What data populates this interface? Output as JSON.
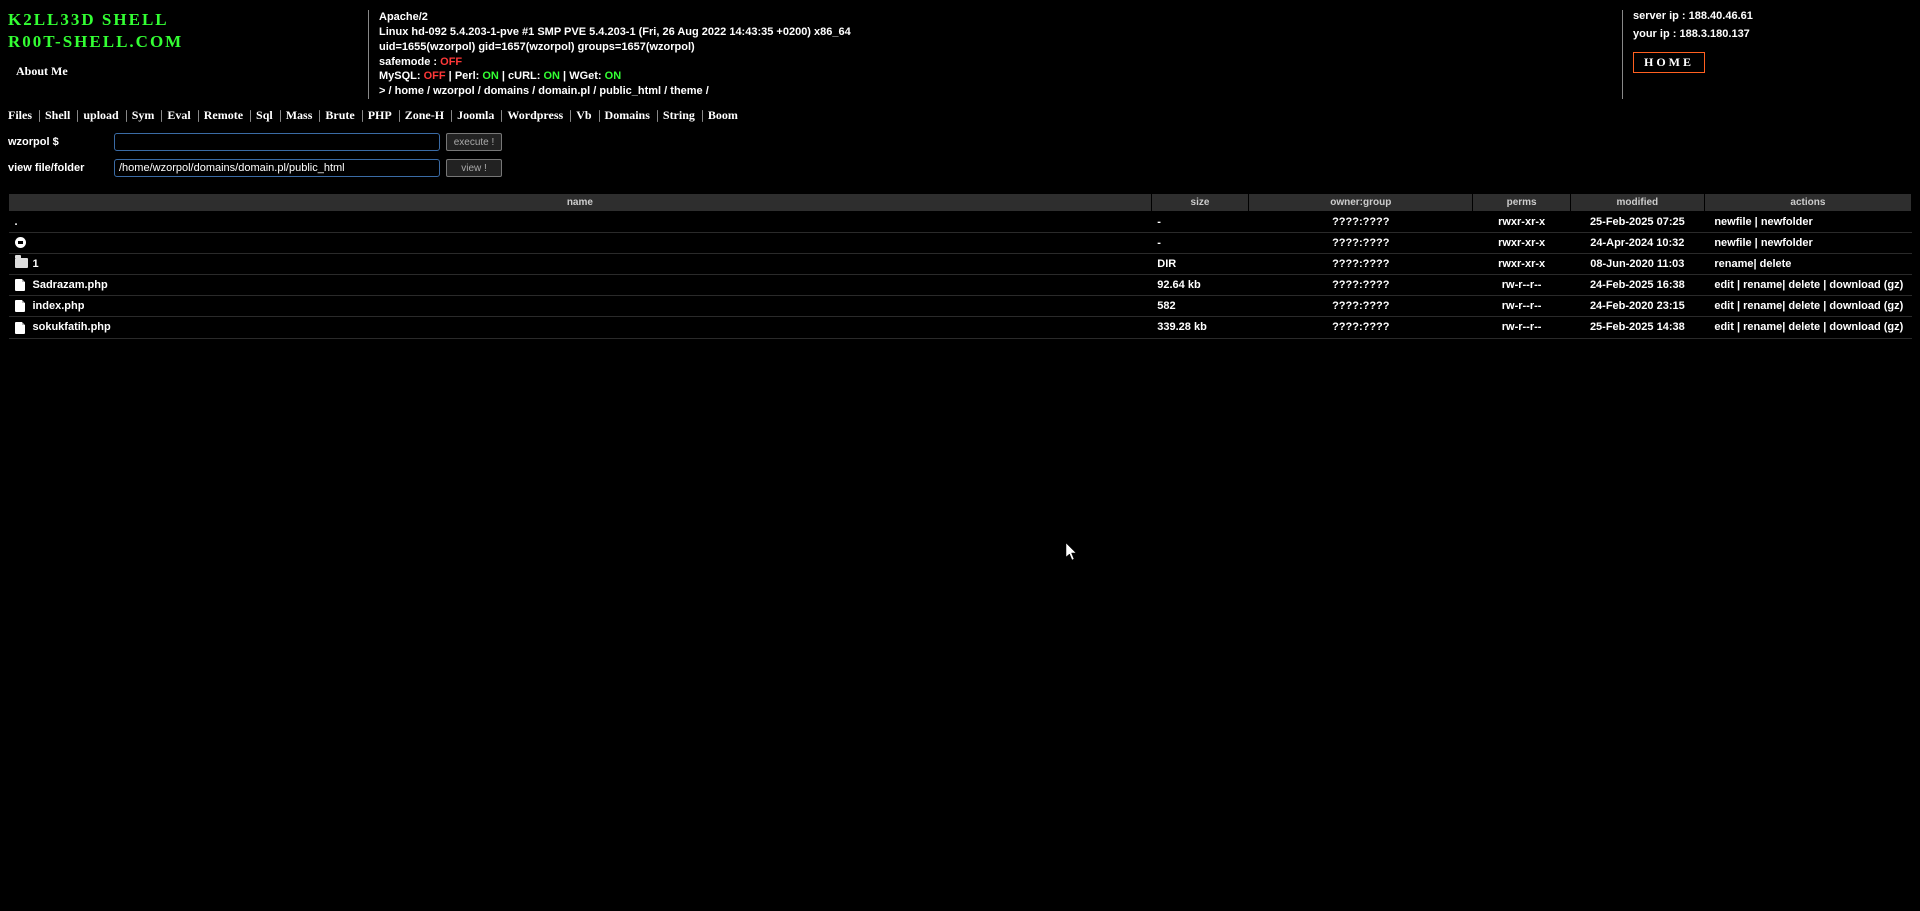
{
  "header": {
    "title1": "K2LL33D SHELL",
    "title2": "R00T-SHELL.COM",
    "about_me": "About Me"
  },
  "sysinfo": {
    "server": "Apache/2",
    "os": "Linux hd-092 5.4.203-1-pve #1 SMP PVE 5.4.203-1 (Fri, 26 Aug 2022 14:43:35 +0200) x86_64",
    "uid": "uid=1655(wzorpol) gid=1657(wzorpol) groups=1657(wzorpol)",
    "safemode_label": "safemode : ",
    "safemode_status": "OFF",
    "mysql_label": "MySQL: ",
    "mysql_status": "OFF",
    "perl_label": "Perl: ",
    "perl_status": "ON",
    "curl_label": "cURL: ",
    "curl_status": "ON",
    "wget_label": "WGet: ",
    "wget_status": "ON",
    "sep": " | ",
    "path_prefix": " >  / ",
    "path_parts": [
      "home",
      "wzorpol",
      "domains",
      "domain.pl",
      "public_html",
      "theme"
    ],
    "path_sep": " / "
  },
  "rightinfo": {
    "server_ip_label": "server ip : ",
    "server_ip": "188.40.46.61",
    "your_ip_label": "your ip : ",
    "your_ip": "188.3.180.137",
    "home_btn": "HOME"
  },
  "menu": [
    "Files",
    "Shell",
    "upload",
    "Sym",
    "Eval",
    "Remote",
    "Sql",
    "Mass",
    "Brute",
    "PHP",
    "Zone-H",
    "Joomla",
    "Wordpress",
    "Vb",
    "Domains",
    "String",
    "Boom"
  ],
  "form": {
    "cmd_label": "wzorpol $",
    "cmd_value": "",
    "execute_btn": "execute !",
    "view_label": "view file/folder",
    "view_value": "/home/wzorpol/domains/domain.pl/public_html",
    "view_btn": "view !"
  },
  "table": {
    "headers": {
      "name": "name",
      "size": "size",
      "owner": "owner:group",
      "perms": "perms",
      "modified": "modified",
      "actions": "actions"
    },
    "rows": [
      {
        "type": "dot",
        "name": ".",
        "size": "-",
        "owner": "????:????",
        "perms": "rwxr-xr-x",
        "modified": "25-Feb-2025 07:25",
        "actions": [
          "newfile",
          "newfolder"
        ],
        "action_sep": " | "
      },
      {
        "type": "up",
        "name": "",
        "size": "-",
        "owner": "????:????",
        "perms": "rwxr-xr-x",
        "modified": "24-Apr-2024 10:32",
        "actions": [
          "newfile",
          "newfolder"
        ],
        "action_sep": " | "
      },
      {
        "type": "folder",
        "name": "1",
        "size": "DIR",
        "owner": "????:????",
        "perms": "rwxr-xr-x",
        "modified": "08-Jun-2020 11:03",
        "actions": [
          "rename",
          "delete"
        ],
        "action_sep": "| "
      },
      {
        "type": "file",
        "name": "Sadrazam.php",
        "size": "92.64 kb",
        "owner": "????:????",
        "perms": "rw-r--r--",
        "modified": "24-Feb-2025 16:38",
        "actions": [
          "edit",
          "rename",
          "delete",
          "download (gz)"
        ],
        "action_sep": " | ",
        "action_sep2": "| "
      },
      {
        "type": "file",
        "name": "index.php",
        "size": "582",
        "owner": "????:????",
        "perms": "rw-r--r--",
        "modified": "24-Feb-2020 23:15",
        "actions": [
          "edit",
          "rename",
          "delete",
          "download (gz)"
        ],
        "action_sep": " | ",
        "action_sep2": "| "
      },
      {
        "type": "file",
        "name": "sokukfatih.php",
        "size": "339.28 kb",
        "owner": "????:????",
        "perms": "rw-r--r--",
        "modified": "25-Feb-2025 14:38",
        "actions": [
          "edit",
          "rename",
          "delete",
          "download (gz)"
        ],
        "action_sep": " | ",
        "action_sep2": "| "
      }
    ]
  }
}
